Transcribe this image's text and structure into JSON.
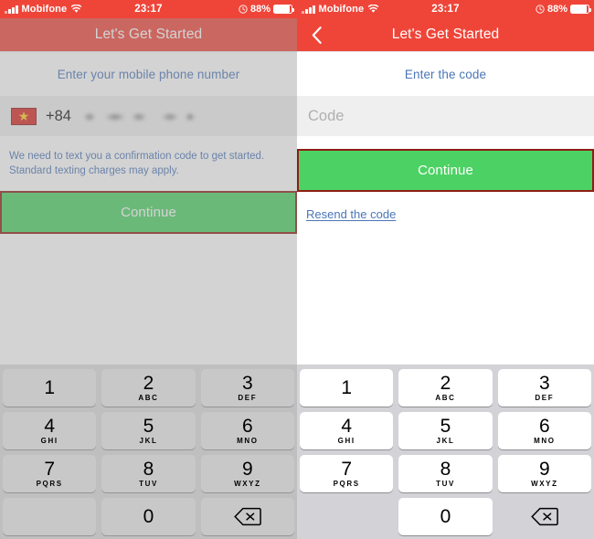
{
  "status_bar": {
    "carrier": "Mobifone",
    "time": "23:17",
    "battery_percent": "88%",
    "signal_icon": "signal-bars-icon",
    "wifi_icon": "wifi-icon",
    "alarm_icon": "alarm-icon",
    "battery_icon": "battery-icon"
  },
  "colors": {
    "nav_red": "#EF4539",
    "cta_green": "#4CD264",
    "link_blue": "#4A76B8",
    "highlight_border": "#8E1D12",
    "keypad_bg": "#d2d2d7"
  },
  "left_screen": {
    "nav_title": "Let's Get Started",
    "prompt": "Enter your mobile phone number",
    "flag": "vietnam-flag-icon",
    "dial_code": "+84",
    "phone_number": "",
    "helper_line_1": "We need to text you a confirmation code to get started.",
    "helper_line_2": "Standard texting charges may apply.",
    "continue_label": "Continue"
  },
  "right_screen": {
    "back_icon": "back-chevron-icon",
    "nav_title": "Let's Get Started",
    "prompt": "Enter the code",
    "code_value": "",
    "code_placeholder": "Code",
    "continue_label": "Continue",
    "resend_label": "Resend the code"
  },
  "keypad": {
    "keys": [
      {
        "num": "1",
        "sub": ""
      },
      {
        "num": "2",
        "sub": "ABC"
      },
      {
        "num": "3",
        "sub": "DEF"
      },
      {
        "num": "4",
        "sub": "GHI"
      },
      {
        "num": "5",
        "sub": "JKL"
      },
      {
        "num": "6",
        "sub": "MNO"
      },
      {
        "num": "7",
        "sub": "PQRS"
      },
      {
        "num": "8",
        "sub": "TUV"
      },
      {
        "num": "9",
        "sub": "WXYZ"
      },
      {
        "num": "0",
        "sub": ""
      }
    ],
    "delete_icon": "backspace-icon"
  }
}
